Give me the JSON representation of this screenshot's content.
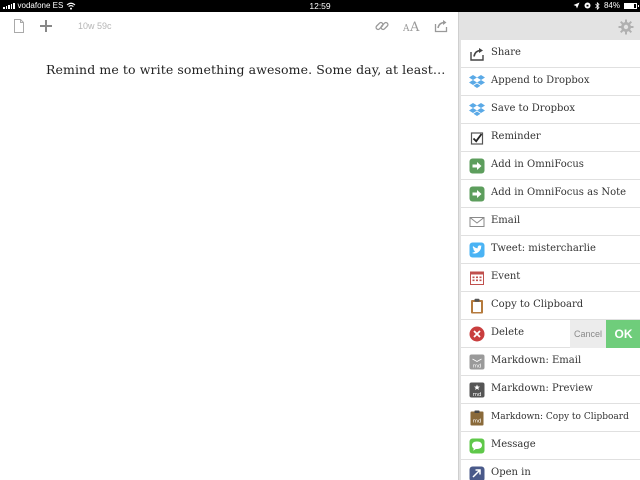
{
  "status_bar": {
    "carrier": "vodafone ES",
    "time": "12:59",
    "battery": "84%",
    "battery_level": 0.84
  },
  "toolbar": {
    "word_count": "10w 59c"
  },
  "editor": {
    "text": "Remind me to write something awesome. Some day, at least…"
  },
  "actions": {
    "share": "Share",
    "append_dropbox": "Append to Dropbox",
    "save_dropbox": "Save to Dropbox",
    "reminder": "Reminder",
    "add_omnifocus": "Add in OmniFocus",
    "add_omnifocus_note": "Add in OmniFocus as Note",
    "email": "Email",
    "tweet": "Tweet: mistercharlie",
    "event": "Event",
    "copy_clipboard": "Copy to Clipboard",
    "delete": "Delete",
    "delete_cancel": "Cancel",
    "delete_ok": "OK",
    "md_email": "Markdown: Email",
    "md_preview": "Markdown: Preview",
    "md_copy": "Markdown: Copy to Clipboard",
    "message": "Message",
    "open_in": "Open in"
  },
  "colors": {
    "ok_green": "#6fcd7b",
    "omnifocus_green": "#5d9e5d",
    "dropbox_blue": "#5aa9e6",
    "twitter_blue": "#4ab3f4",
    "delete_red": "#c93e3e",
    "message_green": "#5fc84a"
  }
}
